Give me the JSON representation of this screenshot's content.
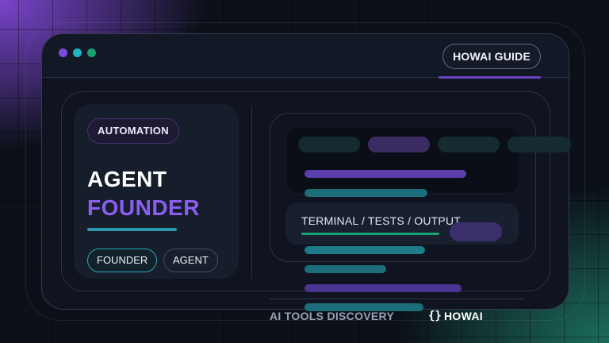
{
  "window": {
    "controls": [
      "purple-dot",
      "cyan-dot",
      "green-dot"
    ],
    "guide_label": "HOWAI GUIDE"
  },
  "left_card": {
    "chip": "AUTOMATION",
    "title_line_1": "AGENT",
    "title_line_2": "FOUNDER",
    "tags": [
      "FOUNDER",
      "AGENT"
    ]
  },
  "right_panel": {
    "terminal_label": "TERMINAL / TESTS / OUTPUT"
  },
  "footer": {
    "left_text": "AI TOOLS DISCOVERY",
    "brace_icon": "{}",
    "brand": "HOWAI"
  },
  "colors": {
    "accent_purple": "#8a5ef0",
    "accent_cyan": "#2b98b0",
    "accent_green": "#1aa372",
    "background": "#0c1119"
  }
}
